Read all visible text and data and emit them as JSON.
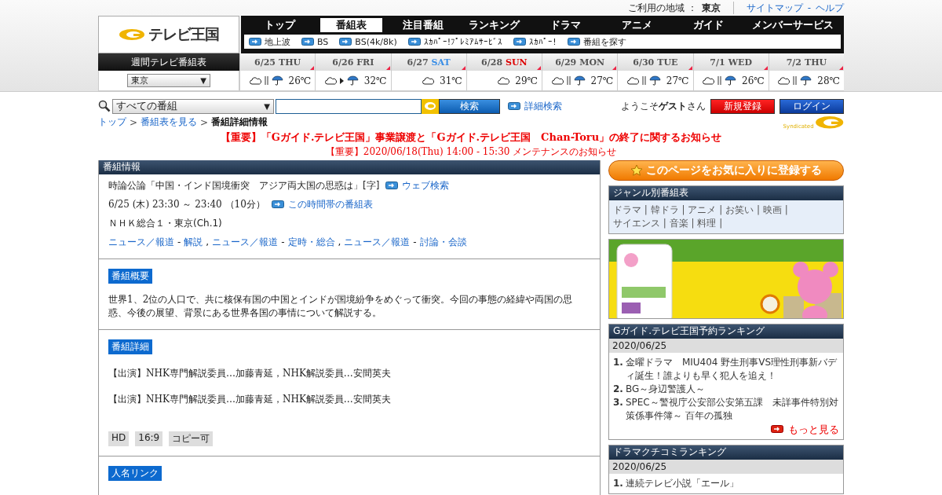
{
  "top_bar": {
    "region_label": "ご利用の地域 ：",
    "region": "東京",
    "links": [
      "サイトマップ",
      "ヘルプ"
    ],
    "separator": "-"
  },
  "logo": {
    "text": "テレビ王国"
  },
  "nav": {
    "tabs": [
      {
        "label": "トップ",
        "selected": false
      },
      {
        "label": "番組表",
        "selected": true
      },
      {
        "label": "注目番組",
        "selected": false
      },
      {
        "label": "ランキング",
        "selected": false
      },
      {
        "label": "ドラマ",
        "selected": false
      },
      {
        "label": "アニメ",
        "selected": false
      },
      {
        "label": "ガイド",
        "selected": false
      },
      {
        "label": "メンバーサービス",
        "selected": false
      }
    ],
    "subnav": [
      "地上波",
      "BS",
      "BS(4k/8k)",
      "ｽｶﾊﾟｰ!ﾌﾟﾚﾐｱﾑｻｰﾋﾞｽ",
      "ｽｶﾊﾟｰ!",
      "番組を探す"
    ]
  },
  "weekly": {
    "title": "週間テレビ番組表",
    "area": "東京",
    "dropdown_arrow": "▼",
    "days": [
      {
        "date": "6/25",
        "weekday": "THU",
        "color": "#555555",
        "kind": "cloudy-sometimes-rain",
        "temp": "26℃"
      },
      {
        "date": "6/26",
        "weekday": "FRI",
        "color": "#555555",
        "kind": "cloudy-then-rain",
        "temp": "32℃"
      },
      {
        "date": "6/27",
        "weekday": "SAT",
        "color": "#3a8ee6",
        "kind": "cloudy",
        "temp": "31℃"
      },
      {
        "date": "6/28",
        "weekday": "SUN",
        "color": "#dd0000",
        "kind": "cloudy",
        "temp": "29℃"
      },
      {
        "date": "6/29",
        "weekday": "MON",
        "color": "#555555",
        "kind": "cloudy-sometimes-rain",
        "temp": "27℃"
      },
      {
        "date": "6/30",
        "weekday": "TUE",
        "color": "#555555",
        "kind": "cloudy-sometimes-rain",
        "temp": "27℃"
      },
      {
        "date": "7/1",
        "weekday": "WED",
        "color": "#555555",
        "kind": "cloudy-sometimes-rain",
        "temp": "26℃"
      },
      {
        "date": "7/2",
        "weekday": "THU",
        "color": "#555555",
        "kind": "cloudy-sometimes-rain",
        "temp": "28℃"
      }
    ]
  },
  "search": {
    "category": "すべての番組",
    "dropdown_arrow": "▼",
    "button": "検索",
    "advanced": "詳細検索",
    "welcome": "ようこそ**ゲスト**さん",
    "register": "新規登録",
    "login": "ログイン"
  },
  "breadcrumb": {
    "separator": ">",
    "items": [
      {
        "label": "トップ",
        "current": false
      },
      {
        "label": "番組表を見る",
        "current": false
      },
      {
        "label": "番組詳細情報",
        "current": true
      }
    ]
  },
  "syndicated": "Syndicated",
  "notices": [
    {
      "kind": "headline",
      "text": "【重要】「Gガイド.テレビ王国」事業譲渡と「Gガイド.テレビ王国　Chan-Toru」の終了に関するお知らせ"
    },
    {
      "kind": "maintenance",
      "text": "【重要】2020/06/18(Thu) 14:00 - 15:30 メンテナンスのお知らせ"
    }
  ],
  "program": {
    "panel_title": "番組情報",
    "title": "時論公論「中国・インド国境衝突　アジア両大国の思惑は」[字]",
    "web_search": "ウェブ検索",
    "time": "6/25 (木) 23:30 ～ 23:40 （10分）",
    "timetable_link": "この時間帯の番組表",
    "channel": "ＮＨＫ総合１・東京(Ch.1)",
    "genre_separator": "-",
    "list_separator": ",",
    "genres": [
      {
        "main": "ニュース／報道",
        "sub": "解説"
      },
      {
        "main": "ニュース／報道",
        "sub": "定時・総合"
      },
      {
        "main": "ニュース／報道",
        "sub": "討論・会談"
      }
    ],
    "sections": [
      {
        "heading": "番組概要",
        "paragraphs": [
          "世界1、2位の人口で、共に核保有国の中国とインドが国境紛争をめぐって衝突。今回の事態の経緯や両国の思惑、今後の展望、背景にある世界各国の事情について解説する。"
        ]
      },
      {
        "heading": "番組詳細",
        "paragraphs": [
          "【出演】NHK専門解説委員…加藤青延，NHK解説委員…安間英夫",
          "【出演】NHK専門解説委員…加藤青延，NHK解説委員…安間英夫"
        ],
        "tags": [
          "HD",
          "16:9",
          "コピー可"
        ]
      },
      {
        "heading": "人名リンク"
      }
    ]
  },
  "favorite_button": "このページをお気に入りに登録する",
  "genre_box": {
    "title": "ジャンル別番組表",
    "separator": "|",
    "links": [
      "ドラマ",
      "韓ドラ",
      "アニメ",
      "お笑い",
      "映画",
      "サイエンス",
      "音楽",
      "料理"
    ]
  },
  "rankings": [
    {
      "title": "Gガイド.テレビ王国予約ランキング",
      "date": "2020/06/25",
      "items": [
        {
          "rank": "1.",
          "title": "金曜ドラマ　MIU404 野生刑事VS理性刑事新バディ誕生！誰よりも早く犯人を追え！"
        },
        {
          "rank": "2.",
          "title": "BG～身辺警護人～"
        },
        {
          "rank": "3.",
          "title": "SPEC～警視庁公安部公安第五課　未詳事件特別対策係事件簿～ 百年の孤独"
        }
      ],
      "more": "もっと見る"
    },
    {
      "title": "ドラマクチコミランキング",
      "date": "2020/06/25",
      "items": [
        {
          "rank": "1.",
          "title": "連続テレビ小説「エール」"
        }
      ]
    }
  ]
}
